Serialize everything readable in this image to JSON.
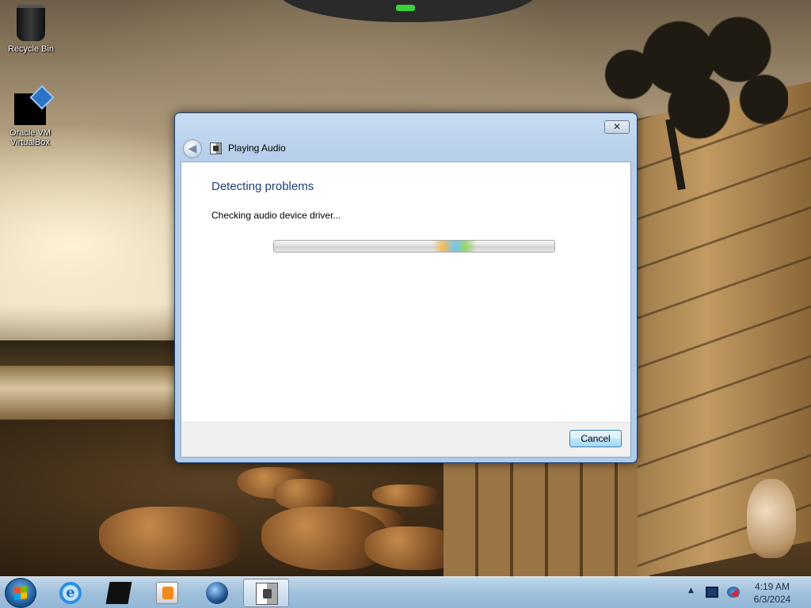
{
  "desktop": {
    "icons": [
      {
        "label": "Recycle Bin",
        "icon": "recycle-bin-icon"
      },
      {
        "label": "Oracle VM VirtualBox",
        "icon": "virtualbox-icon"
      }
    ]
  },
  "dialog": {
    "close_label": "✕",
    "back_label": "◀",
    "title": "Playing Audio",
    "heading": "Detecting problems",
    "status": "Checking audio device driver...",
    "progress": "indeterminate",
    "cancel_label": "Cancel"
  },
  "taskbar": {
    "items": [
      "start-icon",
      "internet-explorer-icon",
      "virtualbox-icon",
      "media-player-icon",
      "globe-icon",
      "troubleshooter-icon"
    ],
    "tray": {
      "overflow_label": "▲",
      "time": "4:19 AM",
      "date": "6/3/2024"
    }
  },
  "colors": {
    "heading": "#1e3f78",
    "taskbar": "#a5c8e6"
  }
}
